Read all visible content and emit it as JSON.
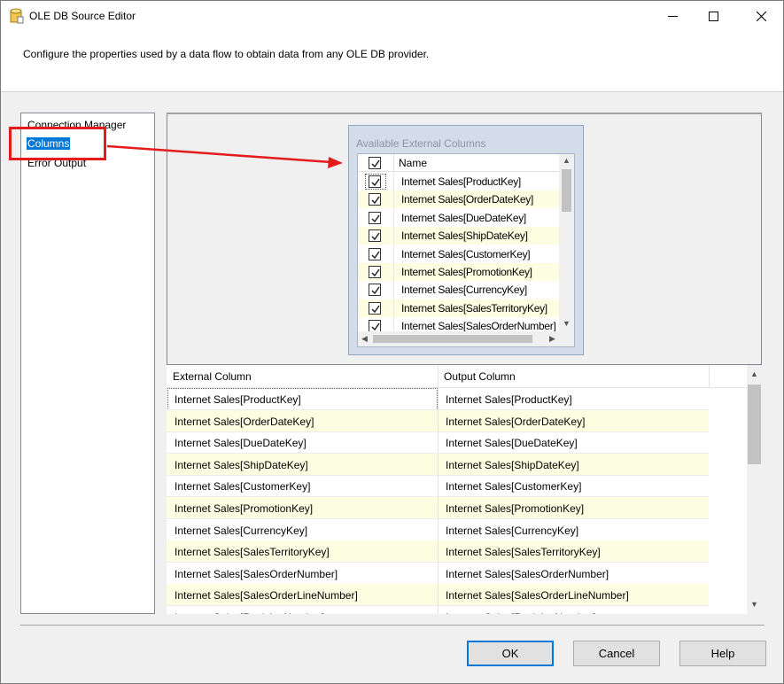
{
  "window": {
    "title": "OLE DB Source Editor"
  },
  "header": {
    "description": "Configure the properties used by a data flow to obtain data from any OLE DB provider."
  },
  "nav": {
    "items": [
      {
        "label": "Connection Manager",
        "selected": false
      },
      {
        "label": "Columns",
        "selected": true
      },
      {
        "label": "Error Output",
        "selected": false
      }
    ]
  },
  "available_columns": {
    "title": "Available External Columns",
    "header_name": "Name",
    "header_checked": true,
    "items": [
      {
        "label": "Internet Sales[ProductKey]",
        "checked": true
      },
      {
        "label": "Internet Sales[OrderDateKey]",
        "checked": true
      },
      {
        "label": "Internet Sales[DueDateKey]",
        "checked": true
      },
      {
        "label": "Internet Sales[ShipDateKey]",
        "checked": true
      },
      {
        "label": "Internet Sales[CustomerKey]",
        "checked": true
      },
      {
        "label": "Internet Sales[PromotionKey]",
        "checked": true
      },
      {
        "label": "Internet Sales[CurrencyKey]",
        "checked": true
      },
      {
        "label": "Internet Sales[SalesTerritoryKey]",
        "checked": true
      },
      {
        "label": "Internet Sales[SalesOrderNumber]",
        "checked": true
      }
    ]
  },
  "mapping_grid": {
    "headers": {
      "external": "External Column",
      "output": "Output Column"
    },
    "rows": [
      {
        "external": "Internet Sales[ProductKey]",
        "output": "Internet Sales[ProductKey]"
      },
      {
        "external": "Internet Sales[OrderDateKey]",
        "output": "Internet Sales[OrderDateKey]"
      },
      {
        "external": "Internet Sales[DueDateKey]",
        "output": "Internet Sales[DueDateKey]"
      },
      {
        "external": "Internet Sales[ShipDateKey]",
        "output": "Internet Sales[ShipDateKey]"
      },
      {
        "external": "Internet Sales[CustomerKey]",
        "output": "Internet Sales[CustomerKey]"
      },
      {
        "external": "Internet Sales[PromotionKey]",
        "output": "Internet Sales[PromotionKey]"
      },
      {
        "external": "Internet Sales[CurrencyKey]",
        "output": "Internet Sales[CurrencyKey]"
      },
      {
        "external": "Internet Sales[SalesTerritoryKey]",
        "output": "Internet Sales[SalesTerritoryKey]"
      },
      {
        "external": "Internet Sales[SalesOrderNumber]",
        "output": "Internet Sales[SalesOrderNumber]"
      },
      {
        "external": "Internet Sales[SalesOrderLineNumber]",
        "output": "Internet Sales[SalesOrderLineNumber]"
      },
      {
        "external": "Internet Sales[RevisionNumber]",
        "output": "Internet Sales[RevisionNumber]"
      }
    ]
  },
  "buttons": {
    "ok": "OK",
    "cancel": "Cancel",
    "help": "Help"
  },
  "colors": {
    "accent": "#0078d7",
    "annotation": "#e51b1b",
    "alt_row": "#fdfde1"
  },
  "icons": {
    "app": "data-source-cylinder-icon",
    "minimize": "minimize-icon",
    "maximize": "maximize-icon",
    "close": "close-icon"
  }
}
